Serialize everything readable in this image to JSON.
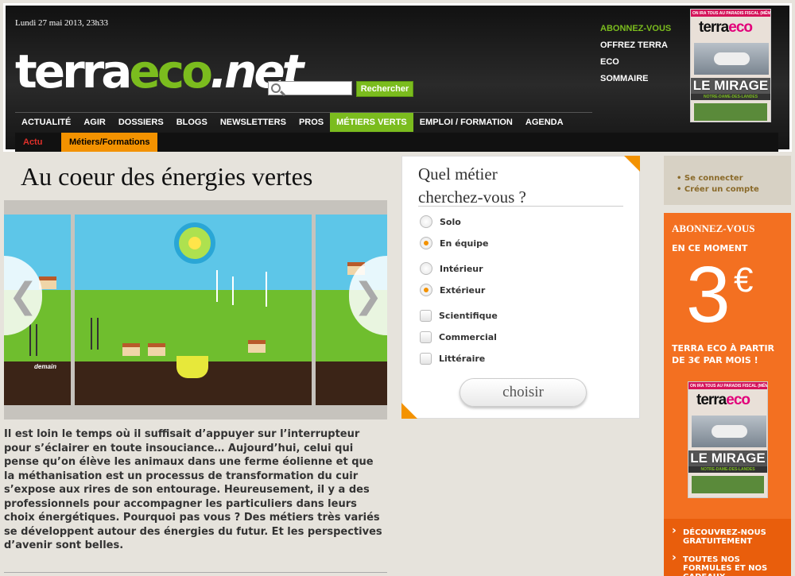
{
  "header": {
    "date": "Lundi 27 mai 2013, 23h33",
    "logo": {
      "part1": "terra",
      "part2": "eco",
      "part3": ".net"
    },
    "search": {
      "value": "",
      "button": "Rechercher"
    },
    "top_links": [
      "ABONNEZ-VOUS",
      "OFFREZ TERRA",
      "ECO",
      "SOMMAIRE"
    ],
    "cover": {
      "banner": "ON IRA TOUS AU PARADIS FISCAL (MÊME VOUS !)",
      "brand1": "terra",
      "brand2": "eco",
      "headline": "LE MIRAGE",
      "subhead": "NOTRE-DAME-DES-LANDES"
    }
  },
  "nav": {
    "items": [
      "ACTUALITÉ",
      "AGIR",
      "DOSSIERS",
      "BLOGS",
      "NEWSLETTERS",
      "PROS",
      "MÉTIERS VERTS",
      "EMPLOI / FORMATION",
      "AGENDA"
    ],
    "active": "MÉTIERS VERTS",
    "sub": {
      "actu": "Actu",
      "active": "Métiers/Formations"
    }
  },
  "article": {
    "title": "Au coeur des énergies vertes",
    "caption": "demain",
    "prev": "❮",
    "next": "❯",
    "body": "Il est loin le temps où il suffisait d’appuyer sur l’interrupteur pour s’éclairer en toute insouciance… Aujourd’hui, celui qui pense qu’on élève les animaux dans une ferme éolienne et que la méthanisation est un processus de transformation du cuir s’expose aux rires de son entourage. Heureusement, il y a des professionnels pour accompagner les particuliers dans leurs choix énergétiques. Pourquoi pas vous ? Des métiers très variés se développent autour des énergies du futur. Et les perspectives d’avenir sont belles."
  },
  "quiz": {
    "question_line1": "Quel métier",
    "question_line2": "cherchez-vous ?",
    "options": [
      {
        "label": "Solo",
        "type": "radio",
        "checked": false
      },
      {
        "label": "En équipe",
        "type": "radio",
        "checked": true
      },
      {
        "label": "Intérieur",
        "type": "radio",
        "checked": false
      },
      {
        "label": "Extérieur",
        "type": "radio",
        "checked": true
      },
      {
        "label": "Scientifique",
        "type": "checkbox",
        "checked": false
      },
      {
        "label": "Commercial",
        "type": "checkbox",
        "checked": false
      },
      {
        "label": "Littéraire",
        "type": "checkbox",
        "checked": false
      }
    ],
    "button": "choisir"
  },
  "account": {
    "login": "Se connecter",
    "register": "Créer un compte"
  },
  "promo": {
    "title": "ABONNEZ-VOUS",
    "subtitle": "EN CE MOMENT",
    "price": "3",
    "currency": "€",
    "text": "TERRA ECO À PARTIR DE 3€ PAR MOIS !",
    "links": [
      "DÉCOUVREZ-NOUS GRATUITEMENT",
      "TOUTES NOS FORMULES ET NOS CADEAUX"
    ]
  },
  "colors": {
    "green": "#7bbc1e",
    "orange": "#f39200",
    "promo": "#f37021",
    "magenta": "#e2007a"
  }
}
